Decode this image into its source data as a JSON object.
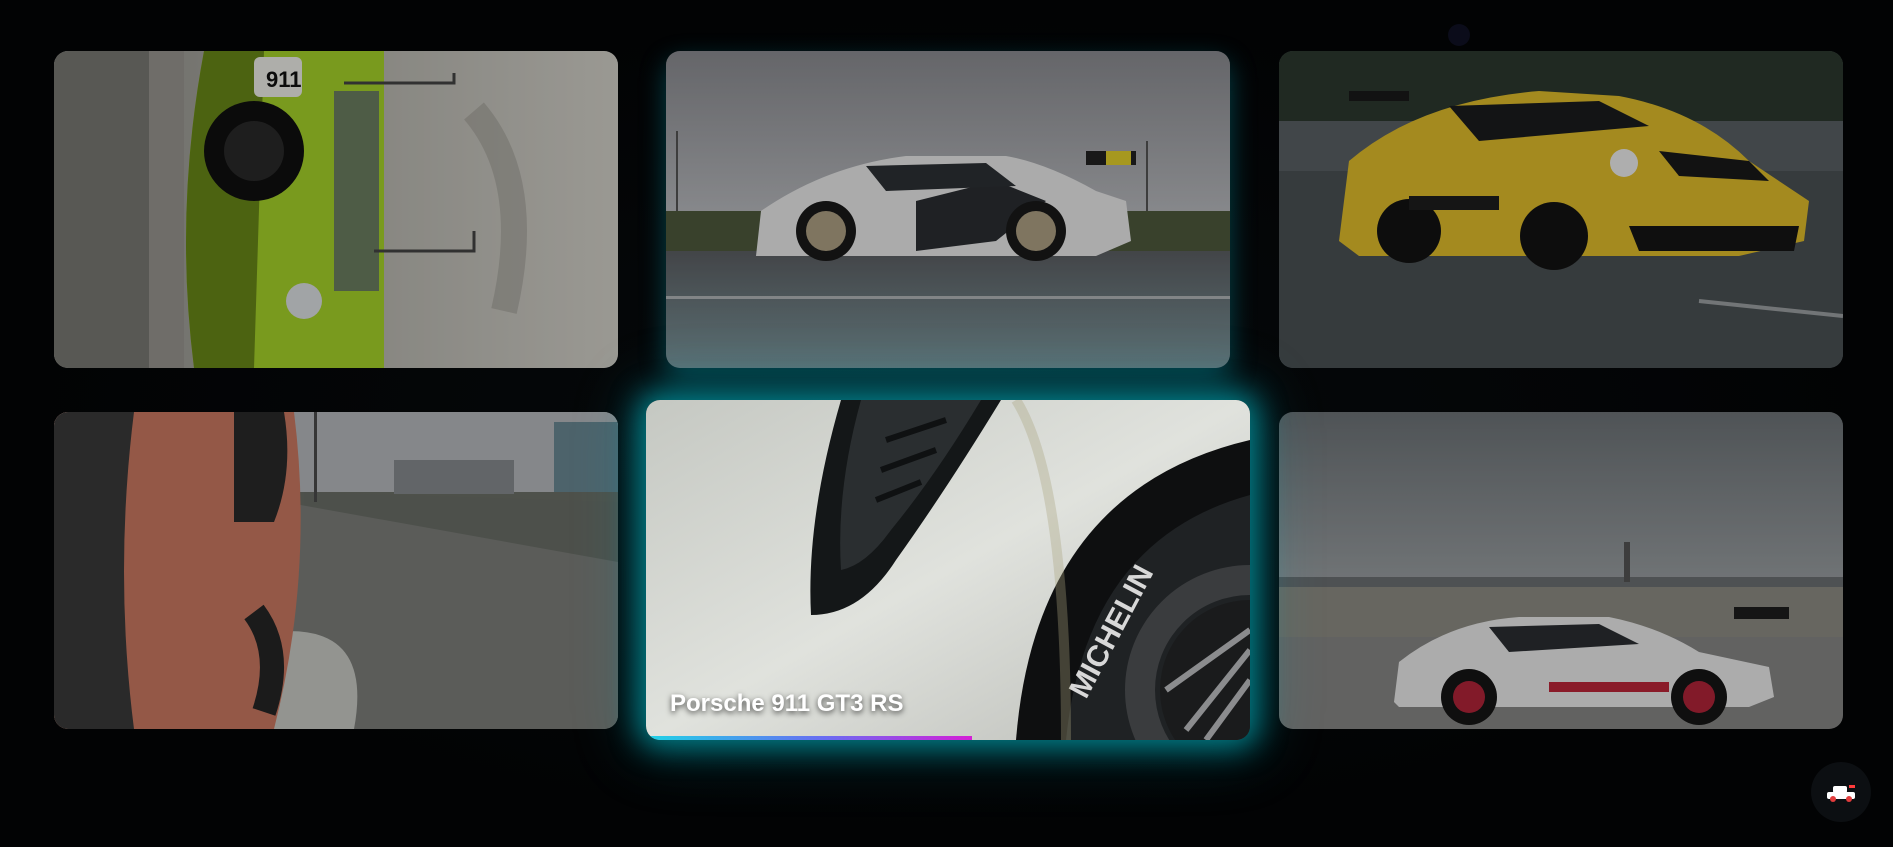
{
  "gallery": {
    "videos": [
      {
        "icon": "green-racecar-thumbnail"
      },
      {
        "icon": "white-gt3-rs-side-thumbnail"
      },
      {
        "icon": "yellow-gt3-rs-road-thumbnail"
      },
      {
        "icon": "orange-car-water-spray-thumbnail"
      },
      {
        "icon": "gt3-rs-wheel-closeup-thumbnail",
        "title": "Porsche 911 GT3 RS",
        "progress": 0.54
      },
      {
        "icon": "white-gt3-rs-parked-thumbnail"
      }
    ]
  },
  "fab": {
    "icon": "car-icon"
  },
  "colors": {
    "accent_glow": "#00c8d7",
    "progress_start": "#1fd3e6",
    "progress_end": "#d41fd6",
    "background": "#030506"
  }
}
